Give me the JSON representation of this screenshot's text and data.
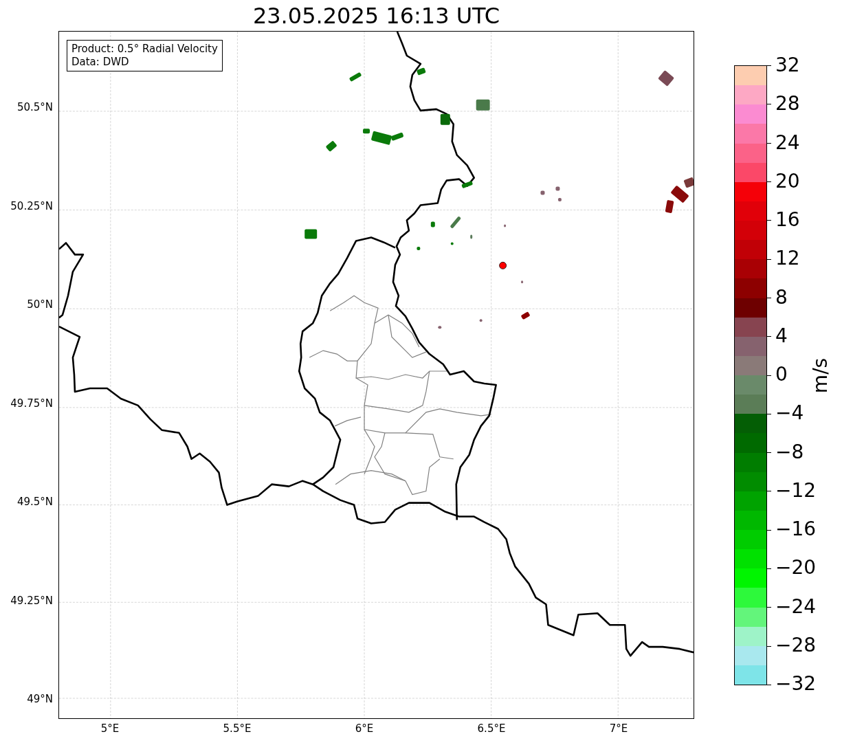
{
  "title": "23.05.2025 16:13 UTC",
  "info_box": {
    "lines": [
      "Product: 0.5° Radial Velocity",
      "Data: DWD"
    ]
  },
  "y_ticks": [
    "50.5°N",
    "50.25°N",
    "50°N",
    "49.75°N",
    "49.5°N",
    "49.25°N",
    "49°N"
  ],
  "x_ticks": [
    "5°E",
    "5.5°E",
    "6°E",
    "6.5°E",
    "7°E"
  ],
  "colorbar": {
    "label": "m/s",
    "ticks": [
      "32",
      "28",
      "24",
      "20",
      "16",
      "12",
      "8",
      "4",
      "0",
      "−4",
      "−8",
      "−12",
      "−16",
      "−20",
      "−24",
      "−28",
      "−32"
    ],
    "bands": [
      {
        "color": "#fdcdb0"
      },
      {
        "color": "#fda8c4"
      },
      {
        "color": "#fb8bd1"
      },
      {
        "color": "#fb78a8"
      },
      {
        "color": "#fb6288"
      },
      {
        "color": "#fb4868"
      },
      {
        "color": "#f50008"
      },
      {
        "color": "#e10009"
      },
      {
        "color": "#d30008"
      },
      {
        "color": "#c10006"
      },
      {
        "color": "#a90004"
      },
      {
        "color": "#8d0000"
      },
      {
        "color": "#6e0000"
      },
      {
        "color": "#874450"
      },
      {
        "color": "#86626e"
      },
      {
        "color": "#8a7a78"
      },
      {
        "color": "#6a8a6a"
      },
      {
        "color": "#5b7d57"
      },
      {
        "color": "#045e05"
      },
      {
        "color": "#006a00"
      },
      {
        "color": "#007d00"
      },
      {
        "color": "#018c00"
      },
      {
        "color": "#00a300"
      },
      {
        "color": "#00b800"
      },
      {
        "color": "#00cc00"
      },
      {
        "color": "#00e100"
      },
      {
        "color": "#00f500"
      },
      {
        "color": "#2df93b"
      },
      {
        "color": "#63f57b"
      },
      {
        "color": "#9ef3c8"
      },
      {
        "color": "#a9e8ee"
      },
      {
        "color": "#7ee4e8"
      }
    ]
  }
}
